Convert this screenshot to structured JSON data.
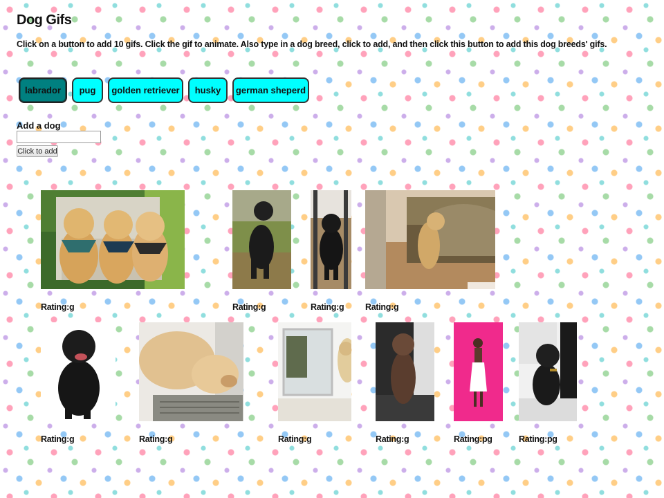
{
  "page": {
    "title": "Dog Gifs",
    "instructions": "Click on a button to add 10 gifs. Click the gif to animate. Also type in a dog breed, click to add, and then click this button to add this dog breeds' gifs."
  },
  "breed_buttons": [
    "labrador",
    "pug",
    "golden retriever",
    "husky",
    "german sheperd"
  ],
  "active_breed": "labrador",
  "add_form": {
    "label": "Add a dog",
    "input_value": "",
    "button_label": "Click to add"
  },
  "gifs": [
    {
      "name": "gif-golden-puppies-on-chair",
      "rating": "Rating:g"
    },
    {
      "name": "gif-black-lab-on-grass",
      "rating": "Rating:g"
    },
    {
      "name": "gif-black-lab-indoors",
      "rating": "Rating:g"
    },
    {
      "name": "gif-yellow-lab-by-sofa",
      "rating": "Rating:g"
    },
    {
      "name": "gif-black-lab-portrait",
      "rating": "Rating:g"
    },
    {
      "name": "gif-sleeping-golden-puppy",
      "rating": "Rating:g"
    },
    {
      "name": "gif-yellow-lab-at-door",
      "rating": "Rating:g"
    },
    {
      "name": "gif-chocolate-lab-jumping",
      "rating": "Rating:g"
    },
    {
      "name": "gif-woman-on-pink-background",
      "rating": "Rating:pg"
    },
    {
      "name": "gif-black-lab-puppy-sitting",
      "rating": "Rating:pg"
    }
  ],
  "colors": {
    "button_bg": "#00ffff",
    "button_active_bg": "#008080"
  }
}
